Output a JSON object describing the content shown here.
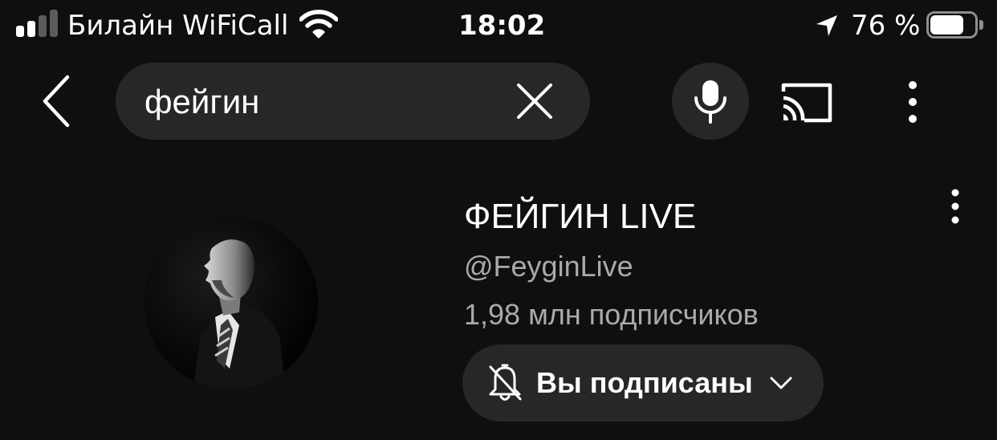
{
  "status_bar": {
    "carrier": "Билайн WiFiCall",
    "time": "18:02",
    "battery_percent": "76 %",
    "battery_level": 0.76,
    "signal_bars_active": 2,
    "signal_bars_total": 4,
    "icons": [
      "signal-icon",
      "wifi-icon",
      "location-arrow-icon",
      "battery-icon"
    ]
  },
  "search_bar": {
    "query": "фейгин",
    "icons": [
      "back-icon",
      "clear-icon",
      "mic-icon",
      "cast-icon",
      "more-vert-icon"
    ]
  },
  "channel_result": {
    "name": "ФЕЙГИН LIVE",
    "handle": "@FeyginLive",
    "subscribers": "1,98 млн подписчиков",
    "subscribe_button_label": "Вы подписаны",
    "icons": [
      "avatar",
      "bell-off-icon",
      "chevron-down-icon",
      "more-vert-icon"
    ]
  },
  "colors": {
    "background": "#0f0f0f",
    "chip_background": "#272727",
    "primary_text": "#ffffff",
    "secondary_text": "#aaaaaa"
  }
}
